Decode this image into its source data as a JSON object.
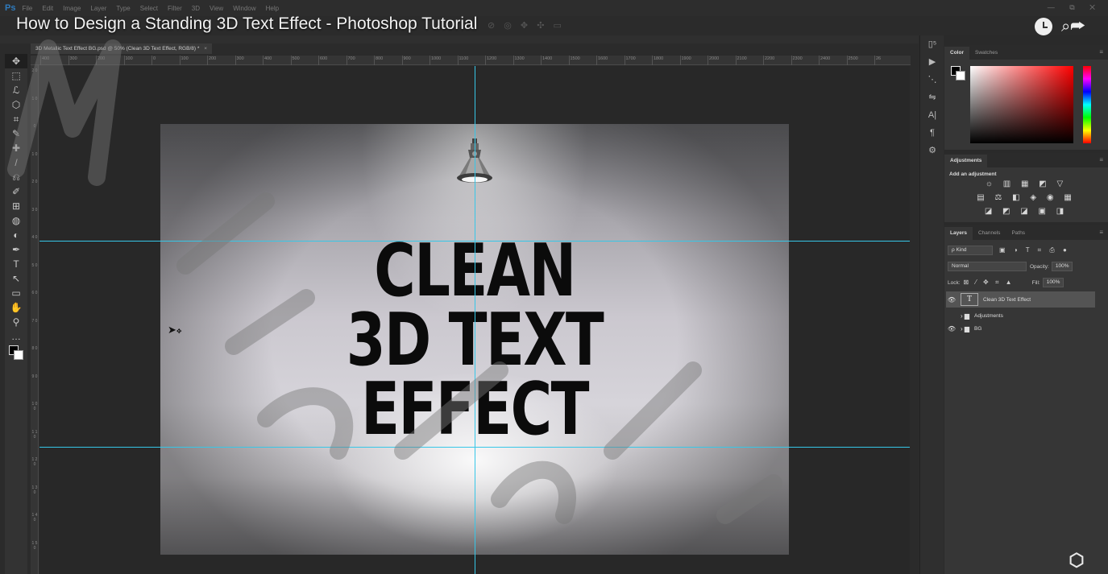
{
  "app": {
    "logo": "Ps",
    "menu": [
      "File",
      "Edit",
      "Image",
      "Layer",
      "Type",
      "Select",
      "Filter",
      "3D",
      "View",
      "Window",
      "Help"
    ],
    "window_controls": "— ⧉ ✕"
  },
  "video": {
    "title": "How to Design a Standing 3D Text Effect - Photoshop Tutorial",
    "title_icons": "⊘ ◎ ✥ ✣ ▭"
  },
  "document": {
    "tab_label": "3D Metallic Text Effect BG.psd @ 50% (Clean 3D Text Effect, RGB/8) *",
    "tab_close": "×",
    "text_lines": [
      "CLEAN",
      "3D TEXT",
      "EFFECT"
    ]
  },
  "ruler": {
    "top_labels": [
      "400",
      "300",
      "200",
      "100",
      "0",
      "100",
      "200",
      "300",
      "400",
      "500",
      "600",
      "700",
      "800",
      "900",
      "1000",
      "1100",
      "1200",
      "1300",
      "1400",
      "1500",
      "1600",
      "1700",
      "1800",
      "1900",
      "2000",
      "2100",
      "2200",
      "2300",
      "2400",
      "2500",
      "26"
    ],
    "left_labels": [
      "2 0",
      "1 0",
      "0",
      "1 0",
      "2 0",
      "3 0",
      "4 0",
      "5 0",
      "6 0",
      "7 0",
      "8 0",
      "9 0",
      "1 0 0",
      "1 1 0",
      "1 2 0",
      "1 3 0",
      "1 4 0",
      "1 5 0"
    ]
  },
  "tools": [
    "✥",
    "⬚",
    "ℒ",
    "⬡",
    "⌗",
    "✎",
    "✚",
    "/",
    "⎌",
    "✐",
    "⊞",
    "◍",
    "◐",
    "✒",
    "T",
    "↖",
    "▭",
    "✋",
    "⚲",
    "…"
  ],
  "dock_icons": [
    "▯⁵",
    "▶",
    "⋱",
    "⇋",
    "A|",
    "¶",
    "⚙"
  ],
  "color_panel": {
    "tabs": [
      "Color",
      "Swatches"
    ],
    "menu": "≡"
  },
  "adjustments_panel": {
    "tab": "Adjustments",
    "menu": "≡",
    "label": "Add an adjustment",
    "row1": "☼ ▥ ▦ ◩ ▽",
    "row2": "▤ ⚖ ◧ ◈ ◉ ▦",
    "row3": "◪ ◩ ◪ ▣ ◨"
  },
  "layers_panel": {
    "tabs": [
      "Layers",
      "Channels",
      "Paths"
    ],
    "menu": "≡",
    "filter_kind": "ρ Kind",
    "filter_icons": "▣ ◑ T ⌗ ⎙ ●",
    "blend_mode": "Normal",
    "opacity_label": "Opacity:",
    "opacity_value": "100%",
    "lock_label": "Lock:",
    "lock_icons": "⊠ ⁄ ✥ ⌗ ▲",
    "fill_label": "Fill:",
    "fill_value": "100%",
    "layers": [
      {
        "name": "Clean 3D Text Effect",
        "type": "text",
        "visible": true,
        "selected": true,
        "thumb": "T"
      },
      {
        "name": "Adjustments",
        "type": "group",
        "visible": false,
        "selected": false
      },
      {
        "name": "BG",
        "type": "group",
        "visible": true,
        "selected": false
      }
    ]
  },
  "colors": {
    "guide": "#36c7e8",
    "ps_blue": "#2f7bbd"
  }
}
